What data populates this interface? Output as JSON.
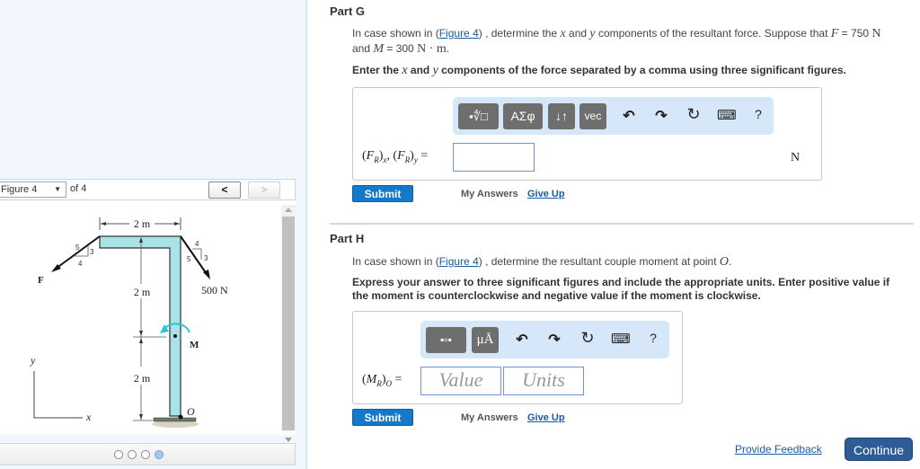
{
  "figure_viewer": {
    "selected_figure": "Figure 4",
    "of_label": "of 4",
    "prev_label": "<",
    "next_label": ">",
    "page_dots": [
      false,
      false,
      false,
      true
    ],
    "diagram": {
      "top_dimension": "2 m",
      "mid_dimension": "2 m",
      "bottom_dimension": "2 m",
      "force_left_label": "F",
      "force_left_slope": {
        "hyp": "5",
        "rise": "3",
        "run": "4"
      },
      "force_right_label": "500 N",
      "force_right_slope": {
        "hyp": "5",
        "rise": "4",
        "run": "3"
      },
      "moment_label": "M",
      "origin_label": "O",
      "axis_x": "x",
      "axis_y": "y",
      "member_color": "#a8e4e6",
      "moment_color": "#2ec4d8"
    }
  },
  "part_g": {
    "title": "Part G",
    "q_prefix": "In case shown in (",
    "figure_link": "Figure 4",
    "q_middle": ") , determine the ",
    "x_var": "x",
    "and": " and ",
    "y_var": "y",
    "q_suffix": " components of the resultant force. Suppose that ",
    "F_var": "F",
    "F_value": " = 750 ",
    "F_unit": "N",
    "line2_prefix": "and ",
    "M_var": "M",
    "M_value": " = 300 ",
    "M_unit": "N · m",
    "instr_prefix": "Enter the ",
    "instr_x": "x",
    "instr_and": " and ",
    "instr_y": "y",
    "instr_suffix": " components of the force separated by a comma using three significant figures.",
    "toolbar": {
      "template_btn": "▪∜□",
      "greek_btn": "ΑΣφ",
      "arrows_btn": "↓↑",
      "vec_btn": "vec",
      "undo": "↶",
      "redo": "↷",
      "reset": "↻",
      "keyboard": "⌨",
      "help": "?"
    },
    "field_label": "(F_R)x, (F_R)y =",
    "input_value": "",
    "unit": "N",
    "submit_label": "Submit",
    "my_answers_label": "My Answers",
    "give_up_label": "Give Up"
  },
  "part_h": {
    "title": "Part H",
    "q_prefix": "In case shown in (",
    "figure_link": "Figure 4",
    "q_suffix": ") , determine the resultant couple moment at point ",
    "O_var": "O",
    "q_end": ".",
    "instr_line1": "Express your answer to three significant figures and include the appropriate units. Enter positive value if",
    "instr_line2": "the moment is counterclockwise and negative value if the moment is clockwise.",
    "toolbar": {
      "template_btn": "▪▫▪",
      "units_btn": "μÅ",
      "undo": "↶",
      "redo": "↷",
      "reset": "↻",
      "keyboard": "⌨",
      "help": "?"
    },
    "field_label": "(M_R)O =",
    "value_placeholder": "Value",
    "units_placeholder": "Units",
    "submit_label": "Submit",
    "my_answers_label": "My Answers",
    "give_up_label": "Give Up"
  },
  "footer": {
    "feedback_label": "Provide Feedback",
    "continue_label": "Continue"
  }
}
